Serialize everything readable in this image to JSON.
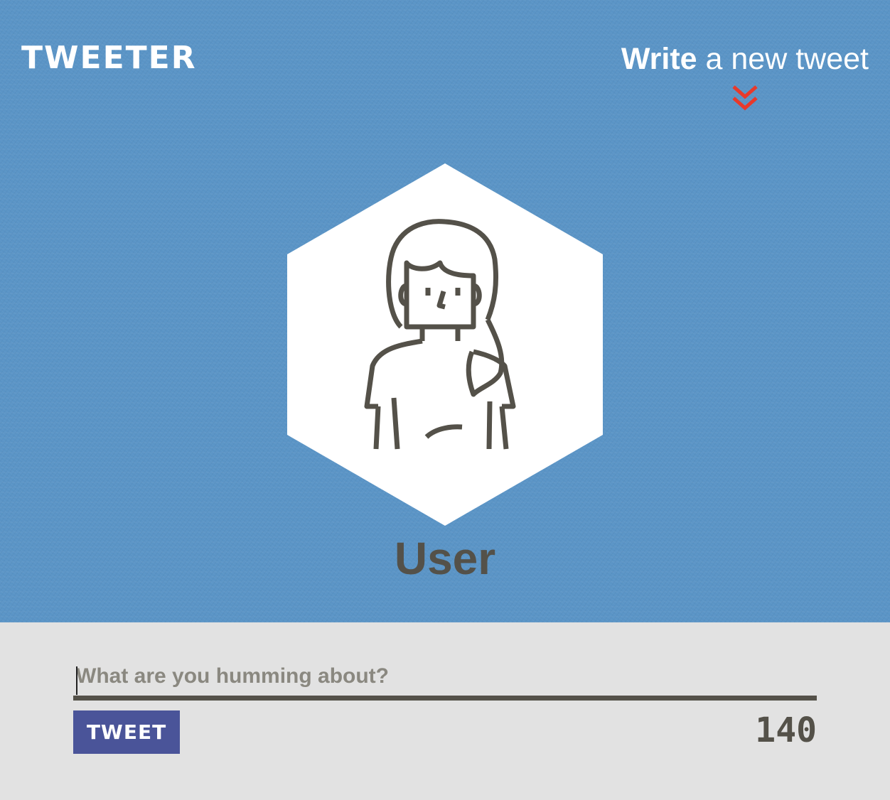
{
  "app": {
    "logo_text": "TWEETER"
  },
  "header": {
    "compose_bold": "Write",
    "compose_rest": " a new tweet",
    "compose_icon": "double-chevron-down-icon",
    "compose_icon_color": "#e8392b"
  },
  "profile": {
    "avatar_icon": "user-avatar-icon",
    "name": "User"
  },
  "composer": {
    "placeholder": "What are you humming about?",
    "value": "",
    "button_label": "TWEET",
    "char_count": "140"
  },
  "colors": {
    "hero_background": "#5a94c6",
    "composer_background": "#e2e2e2",
    "text_dark": "#545149",
    "button_background": "#4a5499"
  }
}
